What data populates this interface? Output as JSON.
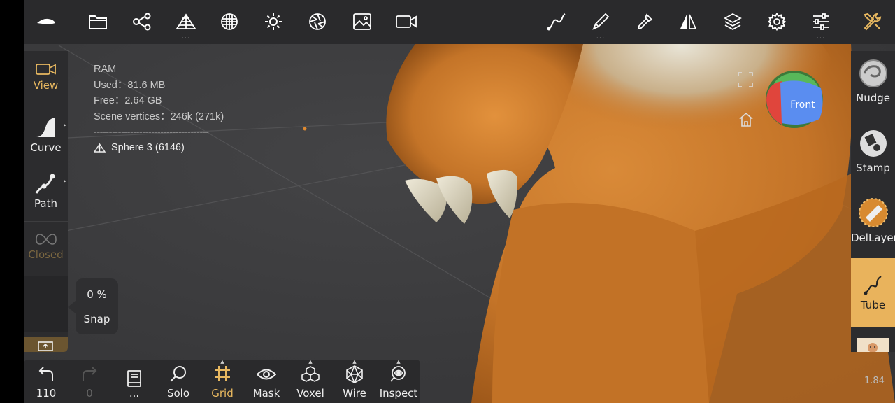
{
  "stats": {
    "ram_label": "RAM",
    "used": "Used：81.6 MB",
    "free": "Free：2.64 GB",
    "vertices": "Scene vertices：246k (271k)",
    "separator": "--------------------------------------",
    "object_name": "Sphere 3 (6146)"
  },
  "left_panel": {
    "view": "View",
    "curve": "Curve",
    "path": "Path",
    "closed": "Closed"
  },
  "snap": {
    "percent": "0 %",
    "label": "Snap"
  },
  "right_panel": {
    "nudge": "Nudge",
    "stamp": "Stamp",
    "dellayer": "DelLayer",
    "tube": "Tube"
  },
  "bottom_bar": {
    "undo_count": "110",
    "redo_count": "0",
    "scene_dots": "...",
    "solo": "Solo",
    "grid": "Grid",
    "mask": "Mask",
    "voxel": "Voxel",
    "wire": "Wire",
    "inspect": "Inspect"
  },
  "gizmo": {
    "face": "Front"
  },
  "version": "1.84",
  "colors": {
    "accent": "#e8b860",
    "toolbar_bg": "#2a2a2c",
    "viewport_bg": "#3a3a3c",
    "model_orange": "#c87a2e"
  },
  "icons": {
    "top_left": [
      "app-logo-icon",
      "folder-icon",
      "share-nodes-icon",
      "topology-icon",
      "material-sphere-icon",
      "light-sun-icon",
      "camera-aperture-icon",
      "background-image-icon",
      "video-camera-icon"
    ],
    "top_right": [
      "stroke-icon",
      "brush-icon",
      "picker-icon",
      "symmetry-icon",
      "layers-icon",
      "settings-gear-icon",
      "sliders-icon",
      "tools-wrench-icon"
    ]
  }
}
